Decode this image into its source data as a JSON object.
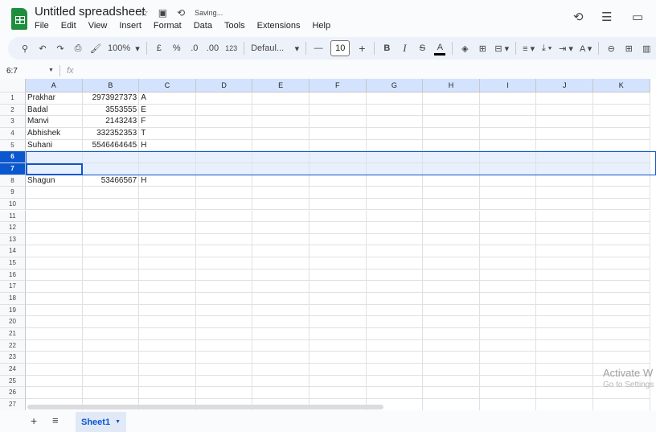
{
  "app": {
    "title": "Untitled spreadsheet",
    "status": "Saving...",
    "accent": "#0b57d0",
    "brand": "#1e8e3e"
  },
  "menu": [
    "File",
    "Edit",
    "View",
    "Insert",
    "Format",
    "Data",
    "Tools",
    "Extensions",
    "Help"
  ],
  "toolbar": {
    "zoom": "100%",
    "currency": "£",
    "percent": "%",
    "dec_decrease": ".0",
    "dec_increase": ".00",
    "format_123": "123",
    "font": "Defaul...",
    "font_size": "10",
    "bold": "B",
    "italic": "I",
    "strike": "S",
    "text_color": "A"
  },
  "formula_bar": {
    "name_box": "6:7",
    "fx": "fx",
    "value": ""
  },
  "columns": [
    "A",
    "B",
    "C",
    "D",
    "E",
    "F",
    "G",
    "H",
    "I",
    "J",
    "K"
  ],
  "row_count": 27,
  "selected_rows": [
    6,
    7
  ],
  "active_cell": "A7",
  "rows": [
    [
      "Prakhar",
      "2973927373",
      "A"
    ],
    [
      "Badal",
      "3553555",
      "E"
    ],
    [
      "Manvi",
      "2143243",
      "F"
    ],
    [
      "Abhishek",
      "332352353",
      "T"
    ],
    [
      "Suhani",
      "5546464645",
      "H"
    ],
    [
      "",
      "",
      ""
    ],
    [
      "",
      "",
      ""
    ],
    [
      "Shagun",
      "53466567",
      "H"
    ]
  ],
  "sheets": [
    {
      "name": "Sheet1",
      "active": true
    }
  ],
  "watermark": {
    "line1": "Activate W",
    "line2": "Go to Settings"
  }
}
